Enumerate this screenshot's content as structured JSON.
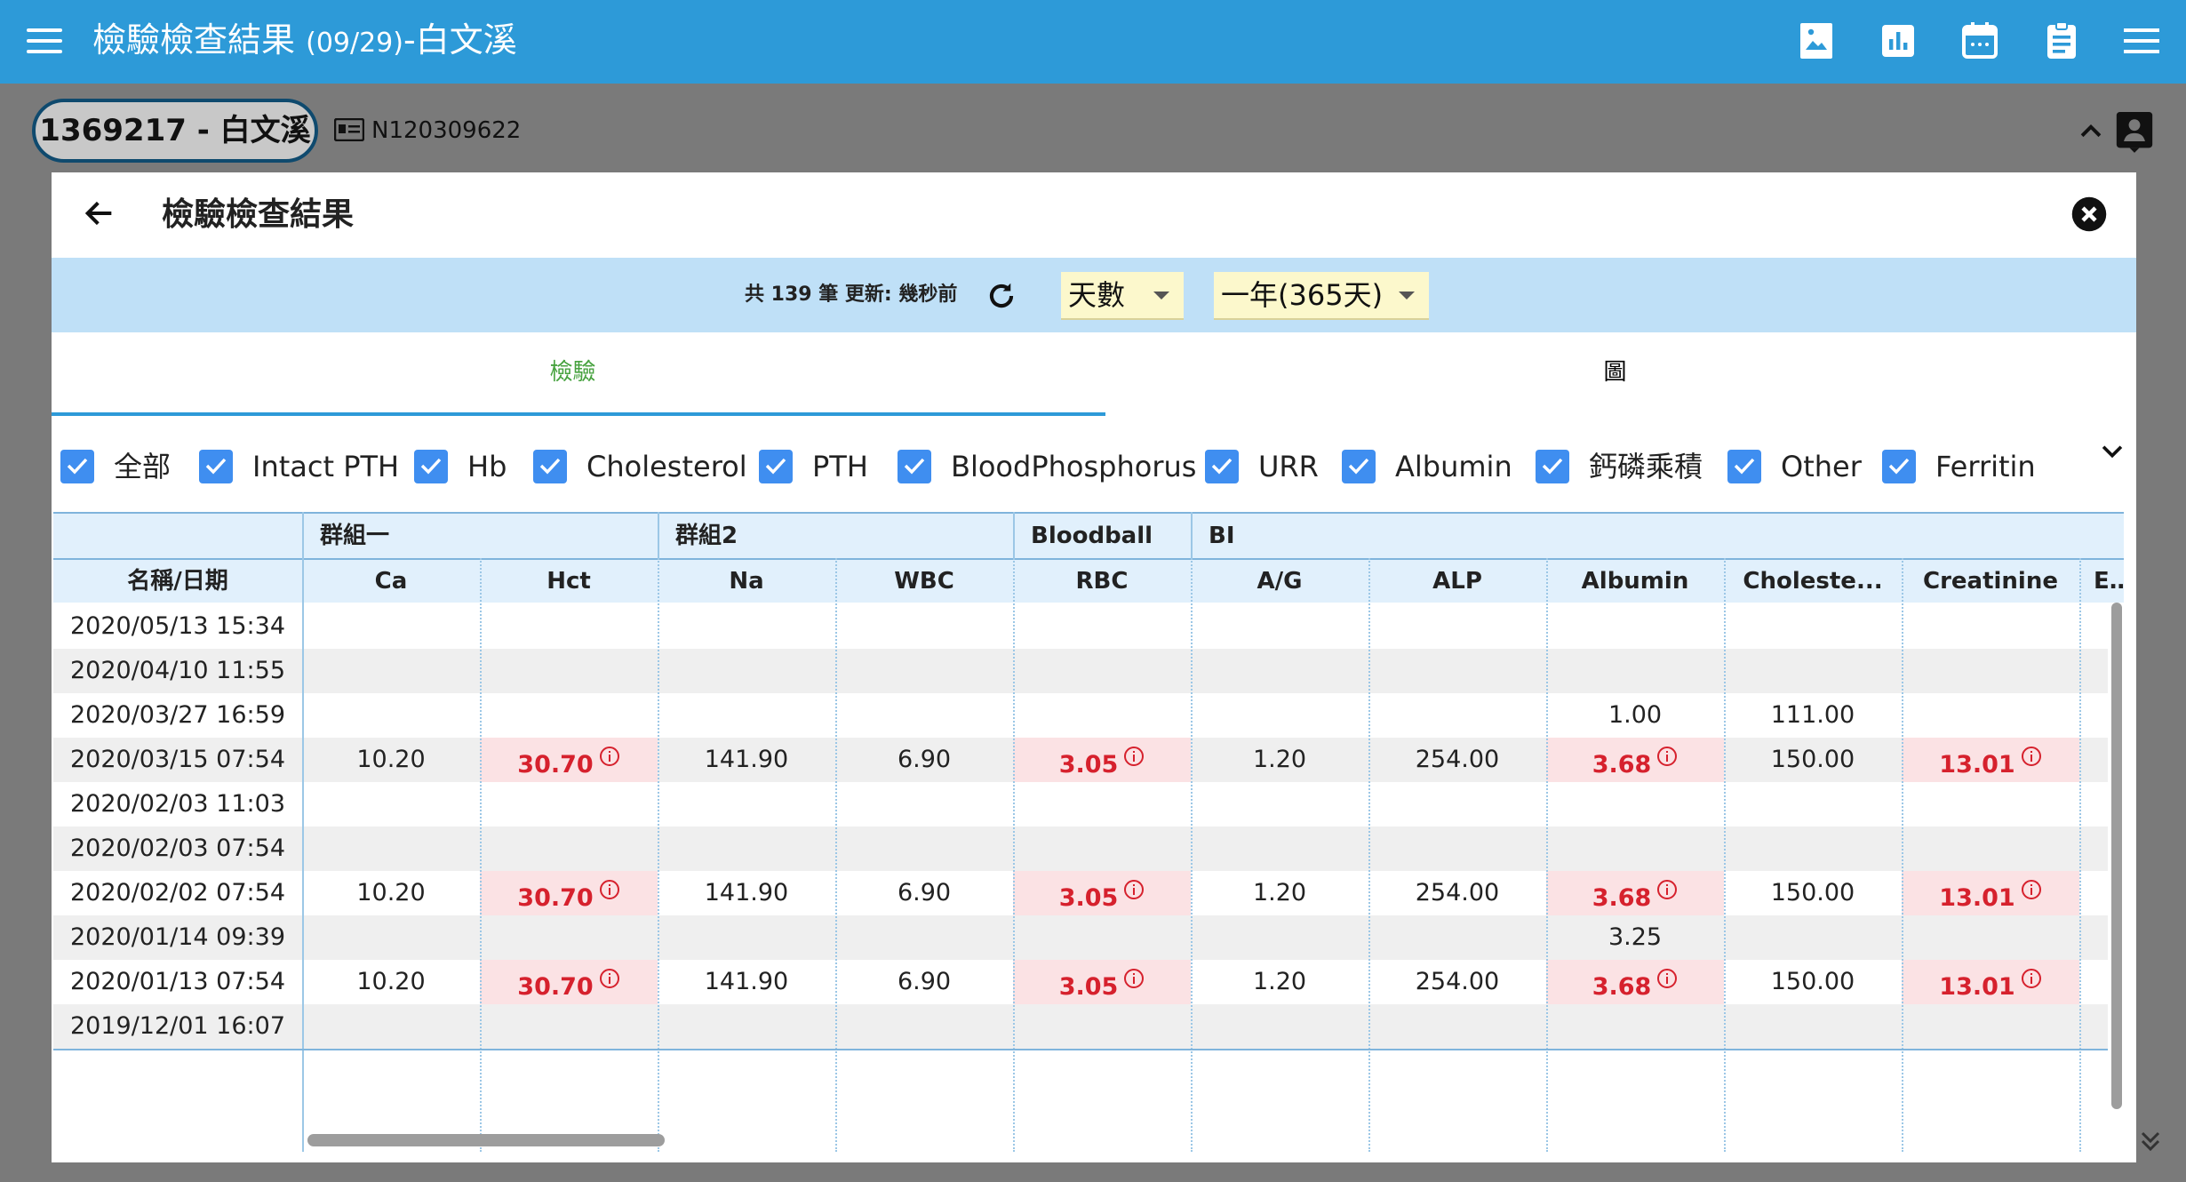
{
  "appbar": {
    "title_prefix": "檢驗檢查結果",
    "title_date": "(09/29)",
    "title_suffix": "-白文溪",
    "icons": [
      "image-icon",
      "bar-chart-icon",
      "calendar-icon",
      "clipboard-icon",
      "menu-icon"
    ]
  },
  "patient": {
    "label": "1369217 - 白文溪",
    "id_number": "N120309622"
  },
  "dialog": {
    "title": "檢驗檢查結果",
    "count_text": "共 139 筆  更新: 幾秒前",
    "unit_select": "天數",
    "range_select": "一年(365天)",
    "tabs": [
      "檢驗",
      "圖"
    ],
    "active_tab": "檢驗"
  },
  "filters": [
    "全部",
    "Intact PTH",
    "Hb",
    "Cholesterol",
    "PTH",
    "BloodPhosphorus",
    "URR",
    "Albumin",
    "鈣磷乘積",
    "Other",
    "Ferritin"
  ],
  "colors": {
    "appbar": "#2d9ad8",
    "checkbox": "#3f8ef0",
    "toolbar": "#bfe0f7",
    "abnormal_text": "#d6212d",
    "abnormal_bg": "#fbe2e4",
    "active_tab": "#47a23f"
  },
  "table": {
    "groups": [
      "",
      "群組一",
      "群組2",
      "Bloodball",
      "BI"
    ],
    "columns": [
      "名稱/日期",
      "Ca",
      "Hct",
      "Na",
      "WBC",
      "RBC",
      "A/G",
      "ALP",
      "Albumin",
      "Choleste...",
      "Creatinine",
      "Est"
    ],
    "rows": [
      {
        "date": "2020/05/13 15:34",
        "cells": [
          "",
          "",
          "",
          "",
          "",
          "",
          "",
          "",
          "",
          ""
        ],
        "abn": [
          false,
          false,
          false,
          false,
          false,
          false,
          false,
          false,
          false,
          false
        ]
      },
      {
        "date": "2020/04/10 11:55",
        "cells": [
          "",
          "",
          "",
          "",
          "",
          "",
          "",
          "",
          "",
          ""
        ],
        "abn": [
          false,
          false,
          false,
          false,
          false,
          false,
          false,
          false,
          false,
          false
        ]
      },
      {
        "date": "2020/03/27 16:59",
        "cells": [
          "",
          "",
          "",
          "",
          "",
          "",
          "",
          "1.00",
          "111.00",
          ""
        ],
        "abn": [
          false,
          false,
          false,
          false,
          false,
          false,
          false,
          false,
          false,
          false
        ]
      },
      {
        "date": "2020/03/15 07:54",
        "cells": [
          "10.20",
          "30.70",
          "141.90",
          "6.90",
          "3.05",
          "1.20",
          "254.00",
          "3.68",
          "150.00",
          "13.01"
        ],
        "abn": [
          false,
          true,
          false,
          false,
          true,
          false,
          false,
          true,
          false,
          true
        ]
      },
      {
        "date": "2020/02/03 11:03",
        "cells": [
          "",
          "",
          "",
          "",
          "",
          "",
          "",
          "",
          "",
          ""
        ],
        "abn": [
          false,
          false,
          false,
          false,
          false,
          false,
          false,
          false,
          false,
          false
        ]
      },
      {
        "date": "2020/02/03 07:54",
        "cells": [
          "",
          "",
          "",
          "",
          "",
          "",
          "",
          "",
          "",
          ""
        ],
        "abn": [
          false,
          false,
          false,
          false,
          false,
          false,
          false,
          false,
          false,
          false
        ]
      },
      {
        "date": "2020/02/02 07:54",
        "cells": [
          "10.20",
          "30.70",
          "141.90",
          "6.90",
          "3.05",
          "1.20",
          "254.00",
          "3.68",
          "150.00",
          "13.01"
        ],
        "abn": [
          false,
          true,
          false,
          false,
          true,
          false,
          false,
          true,
          false,
          true
        ]
      },
      {
        "date": "2020/01/14 09:39",
        "cells": [
          "",
          "",
          "",
          "",
          "",
          "",
          "",
          "3.25",
          "",
          ""
        ],
        "abn": [
          false,
          false,
          false,
          false,
          false,
          false,
          false,
          false,
          false,
          false
        ]
      },
      {
        "date": "2020/01/13 07:54",
        "cells": [
          "10.20",
          "30.70",
          "141.90",
          "6.90",
          "3.05",
          "1.20",
          "254.00",
          "3.68",
          "150.00",
          "13.01"
        ],
        "abn": [
          false,
          true,
          false,
          false,
          true,
          false,
          false,
          true,
          false,
          true
        ]
      },
      {
        "date": "2019/12/01 16:07",
        "cells": [
          "",
          "",
          "",
          "",
          "",
          "",
          "",
          "",
          "",
          ""
        ],
        "abn": [
          false,
          false,
          false,
          false,
          false,
          false,
          false,
          false,
          false,
          false
        ]
      }
    ]
  }
}
